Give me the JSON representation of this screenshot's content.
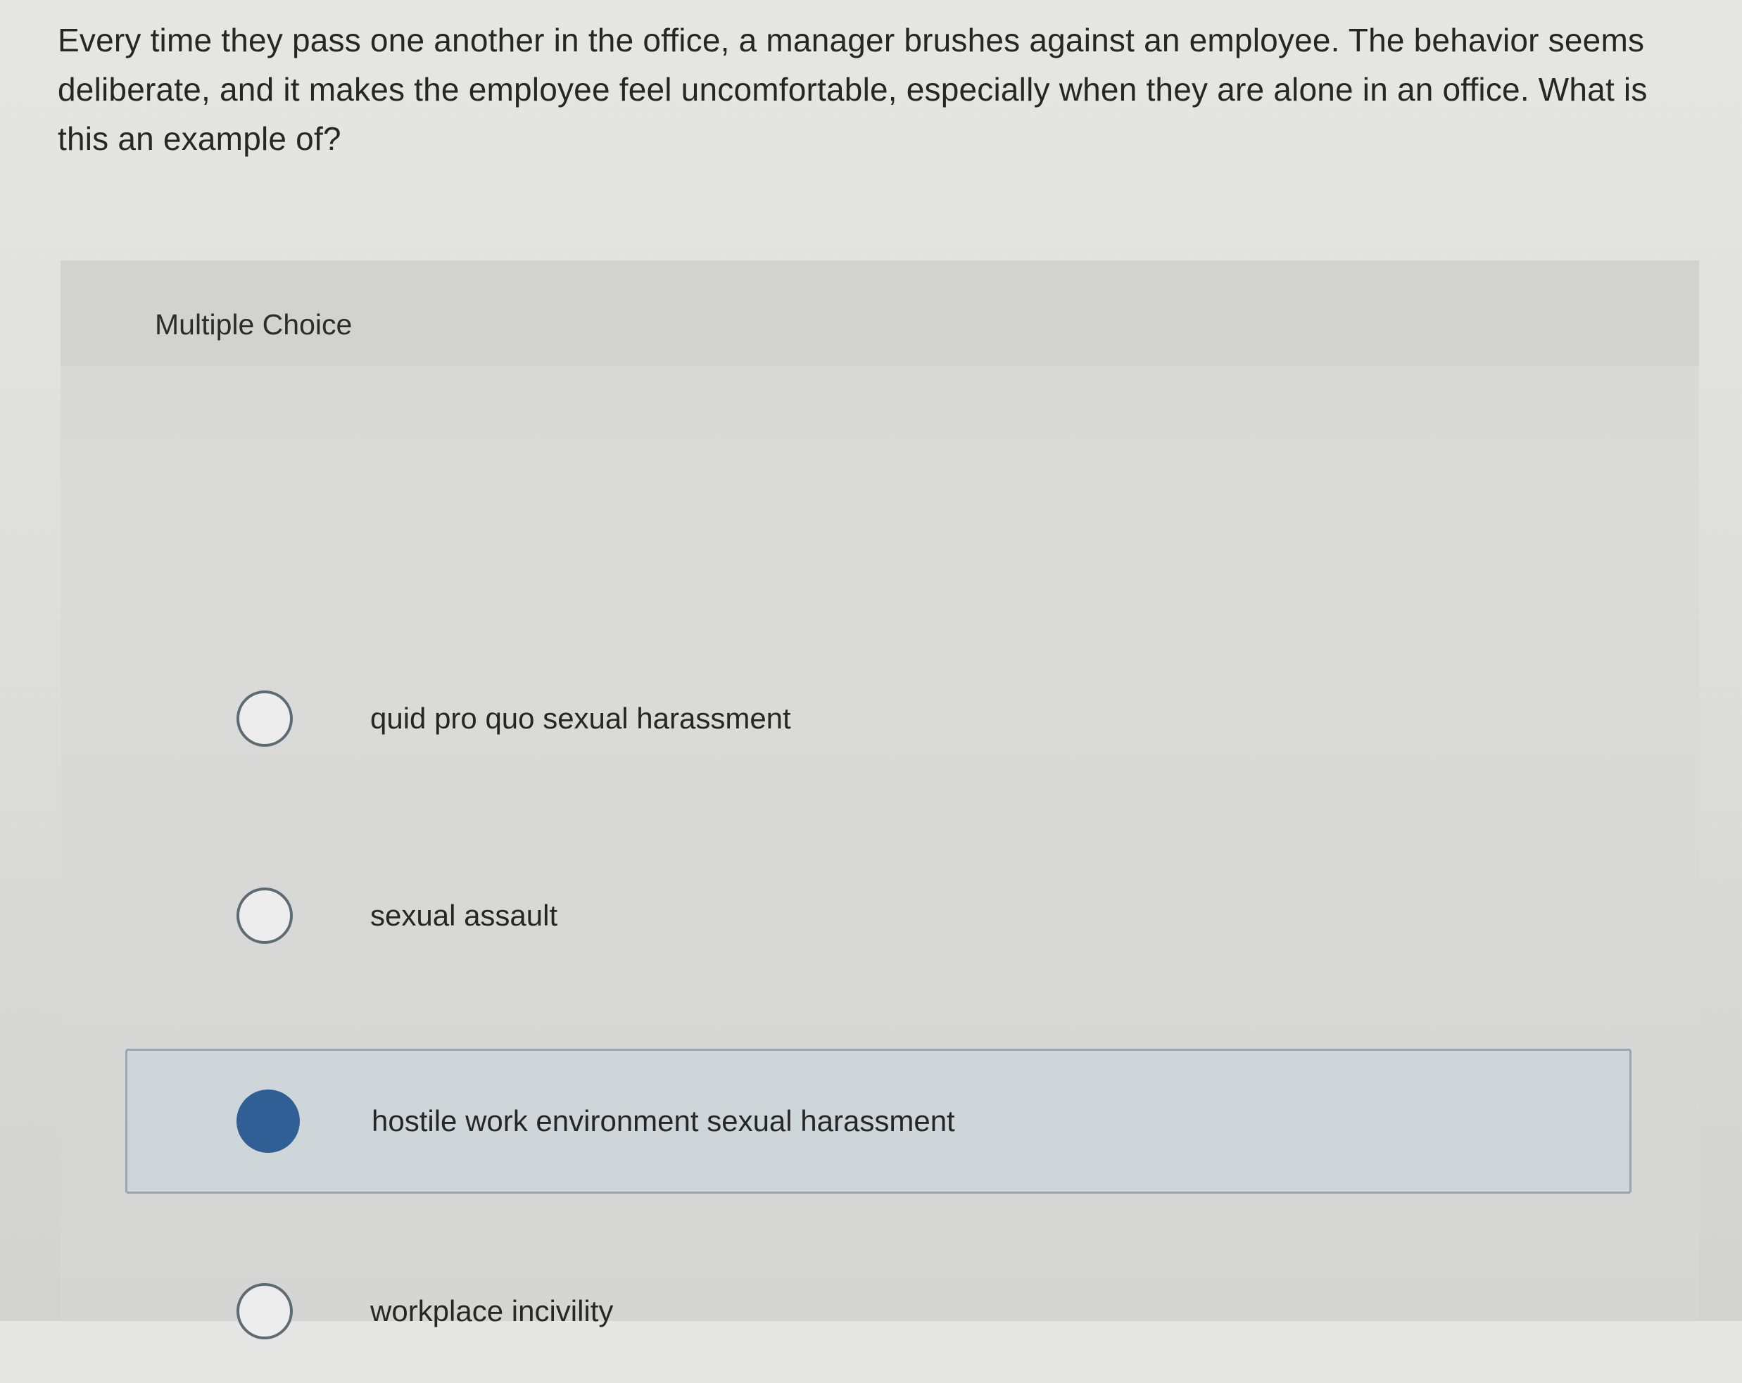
{
  "question": {
    "text": "Every time they pass one another in the office, a manager brushes against an employee. The behavior seems deliberate, and it makes the employee feel uncomfortable, especially when they are alone in an office. What is this an example of?"
  },
  "panel": {
    "label": "Multiple Choice"
  },
  "choices": [
    {
      "label": "quid pro quo sexual harassment",
      "selected": false
    },
    {
      "label": "sexual assault",
      "selected": false
    },
    {
      "label": "hostile work environment sexual harassment",
      "selected": true
    },
    {
      "label": "workplace incivility",
      "selected": false
    }
  ],
  "colors": {
    "selected_radio": "#2f5f95",
    "selected_row_background": "#cfd6da",
    "selected_row_border": "#9aa7af"
  }
}
